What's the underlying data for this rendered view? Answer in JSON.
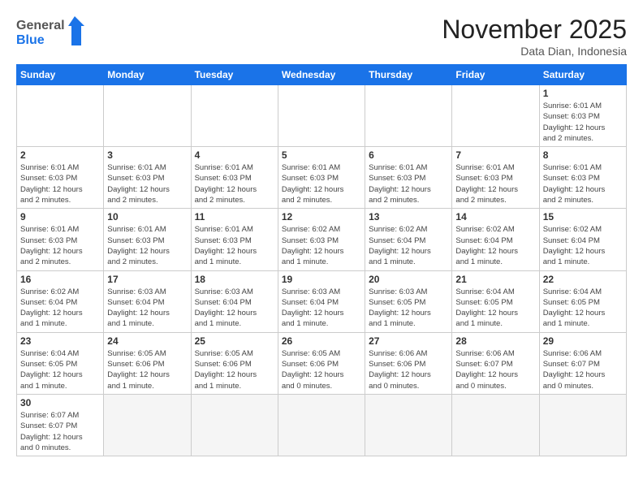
{
  "header": {
    "logo_general": "General",
    "logo_blue": "Blue",
    "month_title": "November 2025",
    "location": "Data Dian, Indonesia"
  },
  "weekdays": [
    "Sunday",
    "Monday",
    "Tuesday",
    "Wednesday",
    "Thursday",
    "Friday",
    "Saturday"
  ],
  "weeks": [
    [
      {
        "day": "",
        "info": ""
      },
      {
        "day": "",
        "info": ""
      },
      {
        "day": "",
        "info": ""
      },
      {
        "day": "",
        "info": ""
      },
      {
        "day": "",
        "info": ""
      },
      {
        "day": "",
        "info": ""
      },
      {
        "day": "1",
        "info": "Sunrise: 6:01 AM\nSunset: 6:03 PM\nDaylight: 12 hours\nand 2 minutes."
      }
    ],
    [
      {
        "day": "2",
        "info": "Sunrise: 6:01 AM\nSunset: 6:03 PM\nDaylight: 12 hours\nand 2 minutes."
      },
      {
        "day": "3",
        "info": "Sunrise: 6:01 AM\nSunset: 6:03 PM\nDaylight: 12 hours\nand 2 minutes."
      },
      {
        "day": "4",
        "info": "Sunrise: 6:01 AM\nSunset: 6:03 PM\nDaylight: 12 hours\nand 2 minutes."
      },
      {
        "day": "5",
        "info": "Sunrise: 6:01 AM\nSunset: 6:03 PM\nDaylight: 12 hours\nand 2 minutes."
      },
      {
        "day": "6",
        "info": "Sunrise: 6:01 AM\nSunset: 6:03 PM\nDaylight: 12 hours\nand 2 minutes."
      },
      {
        "day": "7",
        "info": "Sunrise: 6:01 AM\nSunset: 6:03 PM\nDaylight: 12 hours\nand 2 minutes."
      },
      {
        "day": "8",
        "info": "Sunrise: 6:01 AM\nSunset: 6:03 PM\nDaylight: 12 hours\nand 2 minutes."
      }
    ],
    [
      {
        "day": "9",
        "info": "Sunrise: 6:01 AM\nSunset: 6:03 PM\nDaylight: 12 hours\nand 2 minutes."
      },
      {
        "day": "10",
        "info": "Sunrise: 6:01 AM\nSunset: 6:03 PM\nDaylight: 12 hours\nand 2 minutes."
      },
      {
        "day": "11",
        "info": "Sunrise: 6:01 AM\nSunset: 6:03 PM\nDaylight: 12 hours\nand 1 minute."
      },
      {
        "day": "12",
        "info": "Sunrise: 6:02 AM\nSunset: 6:03 PM\nDaylight: 12 hours\nand 1 minute."
      },
      {
        "day": "13",
        "info": "Sunrise: 6:02 AM\nSunset: 6:04 PM\nDaylight: 12 hours\nand 1 minute."
      },
      {
        "day": "14",
        "info": "Sunrise: 6:02 AM\nSunset: 6:04 PM\nDaylight: 12 hours\nand 1 minute."
      },
      {
        "day": "15",
        "info": "Sunrise: 6:02 AM\nSunset: 6:04 PM\nDaylight: 12 hours\nand 1 minute."
      }
    ],
    [
      {
        "day": "16",
        "info": "Sunrise: 6:02 AM\nSunset: 6:04 PM\nDaylight: 12 hours\nand 1 minute."
      },
      {
        "day": "17",
        "info": "Sunrise: 6:03 AM\nSunset: 6:04 PM\nDaylight: 12 hours\nand 1 minute."
      },
      {
        "day": "18",
        "info": "Sunrise: 6:03 AM\nSunset: 6:04 PM\nDaylight: 12 hours\nand 1 minute."
      },
      {
        "day": "19",
        "info": "Sunrise: 6:03 AM\nSunset: 6:04 PM\nDaylight: 12 hours\nand 1 minute."
      },
      {
        "day": "20",
        "info": "Sunrise: 6:03 AM\nSunset: 6:05 PM\nDaylight: 12 hours\nand 1 minute."
      },
      {
        "day": "21",
        "info": "Sunrise: 6:04 AM\nSunset: 6:05 PM\nDaylight: 12 hours\nand 1 minute."
      },
      {
        "day": "22",
        "info": "Sunrise: 6:04 AM\nSunset: 6:05 PM\nDaylight: 12 hours\nand 1 minute."
      }
    ],
    [
      {
        "day": "23",
        "info": "Sunrise: 6:04 AM\nSunset: 6:05 PM\nDaylight: 12 hours\nand 1 minute."
      },
      {
        "day": "24",
        "info": "Sunrise: 6:05 AM\nSunset: 6:06 PM\nDaylight: 12 hours\nand 1 minute."
      },
      {
        "day": "25",
        "info": "Sunrise: 6:05 AM\nSunset: 6:06 PM\nDaylight: 12 hours\nand 1 minute."
      },
      {
        "day": "26",
        "info": "Sunrise: 6:05 AM\nSunset: 6:06 PM\nDaylight: 12 hours\nand 0 minutes."
      },
      {
        "day": "27",
        "info": "Sunrise: 6:06 AM\nSunset: 6:06 PM\nDaylight: 12 hours\nand 0 minutes."
      },
      {
        "day": "28",
        "info": "Sunrise: 6:06 AM\nSunset: 6:07 PM\nDaylight: 12 hours\nand 0 minutes."
      },
      {
        "day": "29",
        "info": "Sunrise: 6:06 AM\nSunset: 6:07 PM\nDaylight: 12 hours\nand 0 minutes."
      }
    ],
    [
      {
        "day": "30",
        "info": "Sunrise: 6:07 AM\nSunset: 6:07 PM\nDaylight: 12 hours\nand 0 minutes."
      },
      {
        "day": "",
        "info": ""
      },
      {
        "day": "",
        "info": ""
      },
      {
        "day": "",
        "info": ""
      },
      {
        "day": "",
        "info": ""
      },
      {
        "day": "",
        "info": ""
      },
      {
        "day": "",
        "info": ""
      }
    ]
  ]
}
